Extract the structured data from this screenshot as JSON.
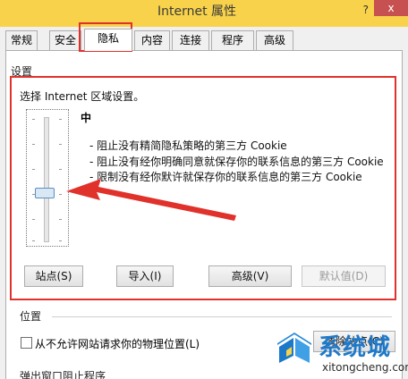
{
  "window": {
    "title": "Internet 属性",
    "help_glyph": "?",
    "close_glyph": "x"
  },
  "tabs": [
    {
      "label": "常规"
    },
    {
      "label": "安全"
    },
    {
      "label": "隐私",
      "selected": true
    },
    {
      "label": "内容"
    },
    {
      "label": "连接"
    },
    {
      "label": "程序"
    },
    {
      "label": "高级"
    }
  ],
  "settings": {
    "group_label": "设置",
    "instruction": "选择 Internet 区域设置。",
    "level": "中",
    "descriptions": [
      "- 阻止没有精简隐私策略的第三方 Cookie",
      "- 阻止没有经你明确同意就保存你的联系信息的第三方 Cookie",
      "- 限制没有经你默许就保存你的联系信息的第三方 Cookie"
    ],
    "buttons": {
      "sites": "站点(S)",
      "import": "导入(I)",
      "advanced": "高级(V)",
      "default": "默认值(D)"
    }
  },
  "location": {
    "group_label": "位置",
    "checkbox_label": "从不允许网站请求你的物理位置(L)",
    "checkbox_checked": false,
    "clear_button": "清除站点(C)"
  },
  "popup": {
    "group_label": "弹出窗口阻止程序"
  },
  "watermark": {
    "brand": "系统城",
    "url": "xitongcheng.com"
  },
  "colors": {
    "titlebar": "#f7d24a",
    "highlight": "#e0312b",
    "watermark": "#1f79c9"
  }
}
